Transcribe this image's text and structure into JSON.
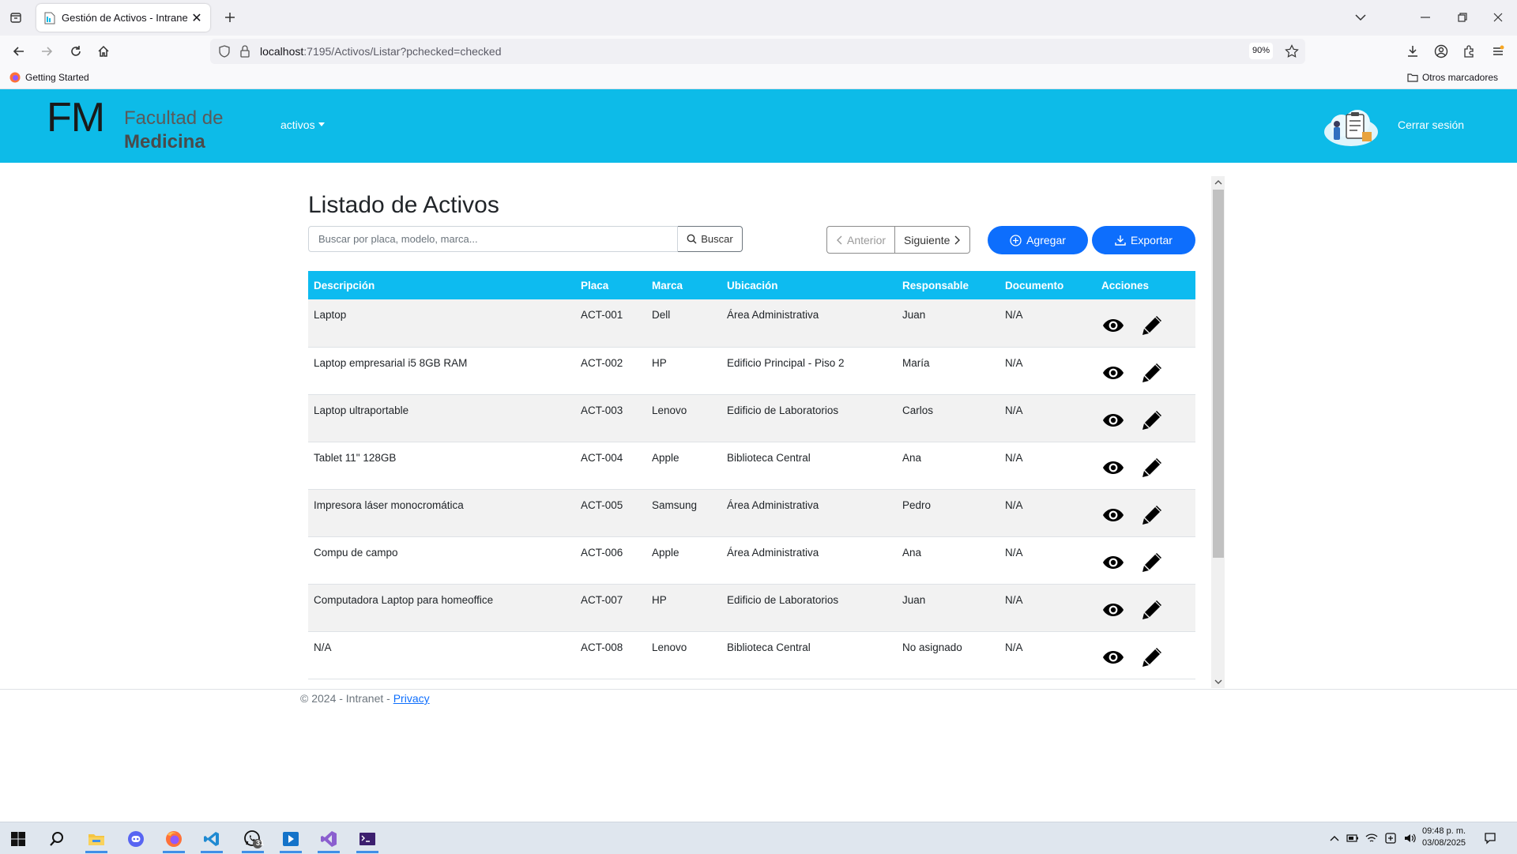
{
  "browser": {
    "tab_title": "Gestión de Activos - Intranet",
    "url_host": "localhost",
    "url_path": ":7195/Activos/Listar?pchecked=checked",
    "zoom": "90%",
    "bookmark_getting_started": "Getting Started",
    "bookmark_other": "Otros marcadores"
  },
  "header": {
    "logo_mark": "FM",
    "logo_line1": "Facultad de",
    "logo_line2": "Medicina",
    "menu_activos": "activos",
    "logout": "Cerrar sesión"
  },
  "main": {
    "title": "Listado de Activos",
    "search_placeholder": "Buscar por placa, modelo, marca...",
    "search_button": "Buscar",
    "prev": "Anterior",
    "next": "Siguiente",
    "add": "Agregar",
    "export": "Exportar"
  },
  "table": {
    "columns": [
      "Descripción",
      "Placa",
      "Marca",
      "Ubicación",
      "Responsable",
      "Documento",
      "Acciones"
    ],
    "rows": [
      {
        "descripcion": "Laptop",
        "placa": "ACT-001",
        "marca": "Dell",
        "ubicacion": "Área Administrativa",
        "responsable": "Juan",
        "documento": "N/A"
      },
      {
        "descripcion": "Laptop empresarial i5 8GB RAM",
        "placa": "ACT-002",
        "marca": "HP",
        "ubicacion": "Edificio Principal - Piso 2",
        "responsable": "María",
        "documento": "N/A"
      },
      {
        "descripcion": "Laptop ultraportable",
        "placa": "ACT-003",
        "marca": "Lenovo",
        "ubicacion": "Edificio de Laboratorios",
        "responsable": "Carlos",
        "documento": "N/A"
      },
      {
        "descripcion": "Tablet 11\" 128GB",
        "placa": "ACT-004",
        "marca": "Apple",
        "ubicacion": "Biblioteca Central",
        "responsable": "Ana",
        "documento": "N/A"
      },
      {
        "descripcion": "Impresora láser monocromática",
        "placa": "ACT-005",
        "marca": "Samsung",
        "ubicacion": "Área Administrativa",
        "responsable": "Pedro",
        "documento": "N/A"
      },
      {
        "descripcion": "Compu de campo",
        "placa": "ACT-006",
        "marca": "Apple",
        "ubicacion": "Área Administrativa",
        "responsable": "Ana",
        "documento": "N/A"
      },
      {
        "descripcion": "Computadora Laptop para homeoffice",
        "placa": "ACT-007",
        "marca": "HP",
        "ubicacion": "Edificio de Laboratorios",
        "responsable": "Juan",
        "documento": "N/A"
      },
      {
        "descripcion": "N/A",
        "placa": "ACT-008",
        "marca": "Lenovo",
        "ubicacion": "Biblioteca Central",
        "responsable": "No asignado",
        "documento": "N/A"
      }
    ]
  },
  "footer": {
    "copyright": "© 2024 - Intranet - ",
    "privacy": "Privacy"
  },
  "taskbar": {
    "whatsapp_badge": "31",
    "time": "09:48 p. m.",
    "date": "03/08/2025"
  },
  "colors": {
    "brand_cyan": "#0dbbe8",
    "table_header": "#0dbbf0",
    "primary_button": "#0d6efd"
  }
}
